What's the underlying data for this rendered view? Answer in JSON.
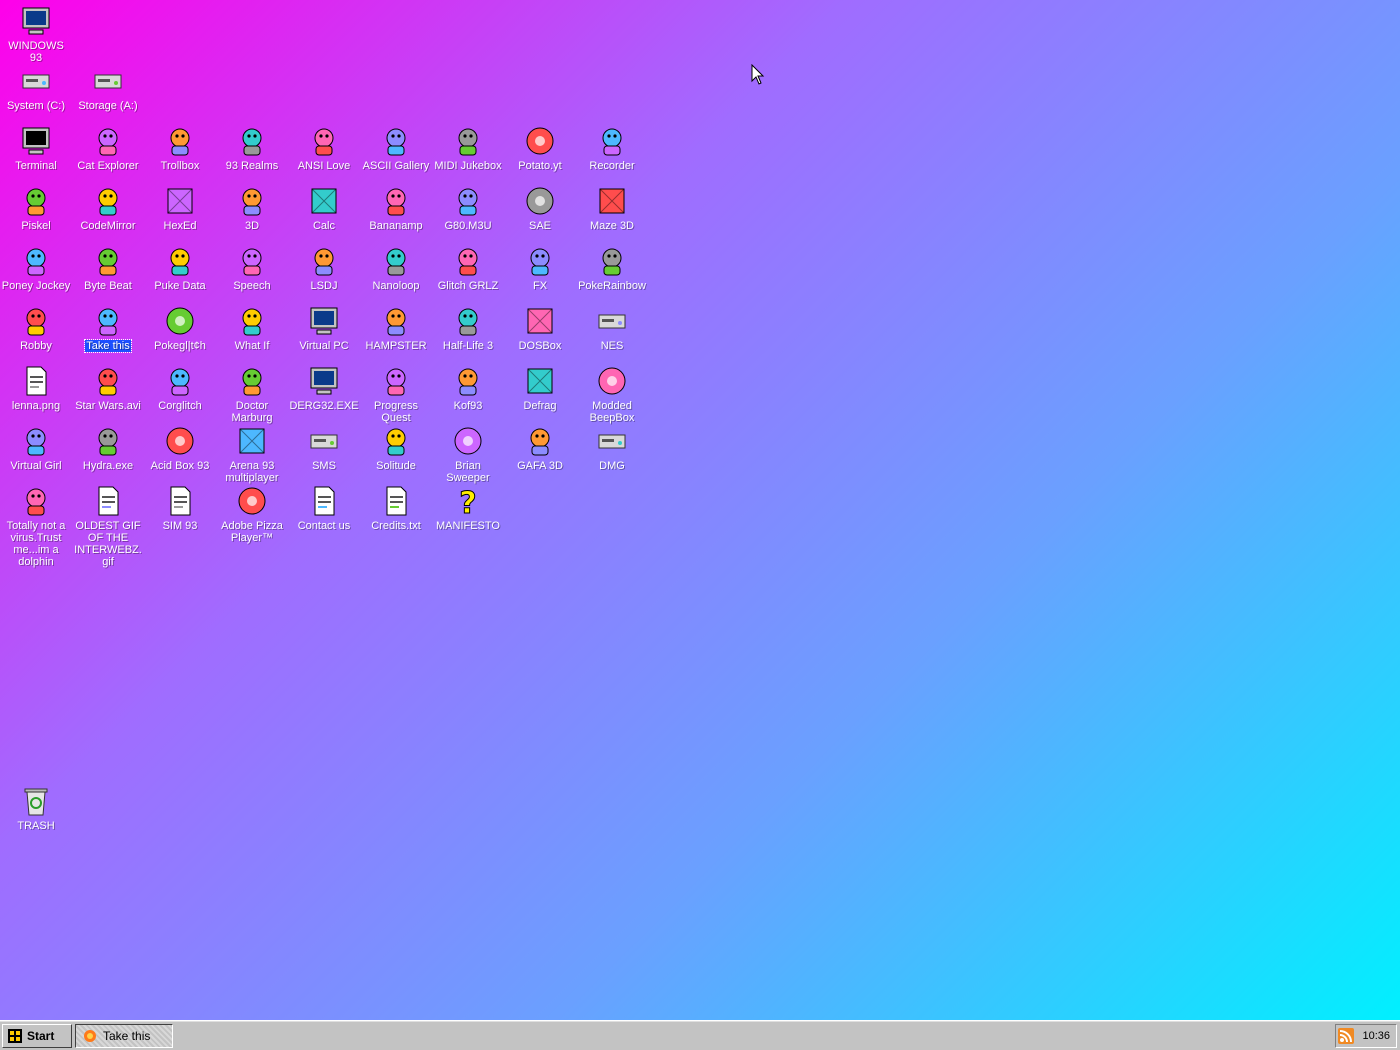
{
  "desktop": {
    "background_colors": [
      "#ff00ea",
      "#a06cff",
      "#6aa0ff",
      "#00f0ff"
    ],
    "icons": [
      {
        "label": "WINDOWS 93",
        "icon": "computer-icon",
        "col": 0,
        "row": 0
      },
      {
        "label": "System (C:)",
        "icon": "drive-icon",
        "col": 0,
        "row": 1
      },
      {
        "label": "Storage (A:)",
        "icon": "floppy-drive-icon",
        "col": 1,
        "row": 1
      },
      {
        "label": "Terminal",
        "icon": "terminal-icon",
        "col": 0,
        "row": 2
      },
      {
        "label": "Cat Explorer",
        "icon": "globe-icon",
        "col": 1,
        "row": 2
      },
      {
        "label": "Trollbox",
        "icon": "chat-icon",
        "col": 2,
        "row": 2
      },
      {
        "label": "93 Realms",
        "icon": "realms-icon",
        "col": 3,
        "row": 2
      },
      {
        "label": "ANSI Love",
        "icon": "ansi-icon",
        "col": 4,
        "row": 2
      },
      {
        "label": "ASCII Gallery",
        "icon": "ascii-icon",
        "col": 5,
        "row": 2
      },
      {
        "label": "MIDI Jukebox",
        "icon": "piano-icon",
        "col": 6,
        "row": 2
      },
      {
        "label": "Potato.yt",
        "icon": "potato-icon",
        "col": 7,
        "row": 2
      },
      {
        "label": "Recorder",
        "icon": "microphone-icon",
        "col": 8,
        "row": 2
      },
      {
        "label": "Piskel",
        "icon": "palette-icon",
        "col": 0,
        "row": 3
      },
      {
        "label": "CodeMirror",
        "icon": "codemirror-icon",
        "col": 1,
        "row": 3
      },
      {
        "label": "HexEd",
        "icon": "hex-icon",
        "col": 2,
        "row": 3
      },
      {
        "label": "3D",
        "icon": "teapot-icon",
        "col": 3,
        "row": 3
      },
      {
        "label": "Calc",
        "icon": "calculator-icon",
        "col": 4,
        "row": 3
      },
      {
        "label": "Bananamp",
        "icon": "banana-icon",
        "col": 5,
        "row": 3
      },
      {
        "label": "G80.M3U",
        "icon": "playlist-icon",
        "col": 6,
        "row": 3
      },
      {
        "label": "SAE",
        "icon": "ball-icon",
        "col": 7,
        "row": 3
      },
      {
        "label": "Maze 3D",
        "icon": "maze-icon",
        "col": 8,
        "row": 3
      },
      {
        "label": "Poney Jockey",
        "icon": "pony-icon",
        "col": 0,
        "row": 4
      },
      {
        "label": "Byte Beat",
        "icon": "bytebeat-icon",
        "col": 1,
        "row": 4
      },
      {
        "label": "Puke Data",
        "icon": "pd-icon",
        "col": 2,
        "row": 4
      },
      {
        "label": "Speech",
        "icon": "face-icon",
        "col": 3,
        "row": 4
      },
      {
        "label": "LSDJ",
        "icon": "lsdj-icon",
        "col": 4,
        "row": 4
      },
      {
        "label": "Nanoloop",
        "icon": "wave-icon",
        "col": 5,
        "row": 4
      },
      {
        "label": "Glitch GRLZ",
        "icon": "lips-icon",
        "col": 6,
        "row": 4
      },
      {
        "label": "FX",
        "icon": "atom-icon",
        "col": 7,
        "row": 4
      },
      {
        "label": "PokeRainbow",
        "icon": "pokerainbow-icon",
        "col": 8,
        "row": 4
      },
      {
        "label": "Robby",
        "icon": "stickman-icon",
        "col": 0,
        "row": 5
      },
      {
        "label": "Take this",
        "icon": "blue-creature-icon",
        "col": 1,
        "row": 5,
        "selected": true
      },
      {
        "label": "Pokegl|t¢h",
        "icon": "pokeball-icon",
        "col": 2,
        "row": 5
      },
      {
        "label": "What If",
        "icon": "whatif-icon",
        "col": 3,
        "row": 5
      },
      {
        "label": "Virtual PC",
        "icon": "window-icon",
        "col": 4,
        "row": 5
      },
      {
        "label": "HAMPSTER",
        "icon": "hamster-icon",
        "col": 5,
        "row": 5
      },
      {
        "label": "Half-Life 3",
        "icon": "lambda-icon",
        "col": 6,
        "row": 5
      },
      {
        "label": "DOSBox",
        "icon": "dosbox-icon",
        "col": 7,
        "row": 5
      },
      {
        "label": "NES",
        "icon": "nes-icon",
        "col": 8,
        "row": 5
      },
      {
        "label": "lenna.png",
        "icon": "image-file-icon",
        "col": 0,
        "row": 6
      },
      {
        "label": "Star Wars.avi",
        "icon": "yoda-icon",
        "col": 1,
        "row": 6
      },
      {
        "label": "Corglitch",
        "icon": "corgi-icon",
        "col": 2,
        "row": 6
      },
      {
        "label": "Doctor Marburg",
        "icon": "doctor-icon",
        "col": 3,
        "row": 6
      },
      {
        "label": "DERG32.EXE",
        "icon": "monitor-face-icon",
        "col": 4,
        "row": 6
      },
      {
        "label": "Progress Quest",
        "icon": "swords-icon",
        "col": 5,
        "row": 6
      },
      {
        "label": "Kof93",
        "icon": "fighter-icon",
        "col": 6,
        "row": 6
      },
      {
        "label": "Defrag",
        "icon": "defrag-icon",
        "col": 7,
        "row": 6
      },
      {
        "label": "Modded BeepBox",
        "icon": "ring-icon",
        "col": 8,
        "row": 6
      },
      {
        "label": "Virtual Girl",
        "icon": "girl-face-icon",
        "col": 0,
        "row": 7
      },
      {
        "label": "Hydra.exe",
        "icon": "hydra-icon",
        "col": 1,
        "row": 7
      },
      {
        "label": "Acid Box 93",
        "icon": "smiley-icon",
        "col": 2,
        "row": 7
      },
      {
        "label": "Arena 93 multiplayer",
        "icon": "cube-icon",
        "col": 3,
        "row": 7
      },
      {
        "label": "SMS",
        "icon": "console-icon",
        "col": 4,
        "row": 7
      },
      {
        "label": "Solitude",
        "icon": "bottle-icon",
        "col": 5,
        "row": 7
      },
      {
        "label": "Brian Sweeper",
        "icon": "mine-icon",
        "col": 6,
        "row": 7
      },
      {
        "label": "GAFA 3D",
        "icon": "man-face-icon",
        "col": 7,
        "row": 7
      },
      {
        "label": "DMG",
        "icon": "gameboy-icon",
        "col": 8,
        "row": 7
      },
      {
        "label": "Totally not a virus.Trust me...im a dolphin",
        "icon": "dolphin-icon",
        "col": 0,
        "row": 8
      },
      {
        "label": "OLDEST GIF OF THE INTERWEBZ.gif",
        "icon": "gif-file-icon",
        "col": 1,
        "row": 8
      },
      {
        "label": "SIM 93",
        "icon": "book-icon",
        "col": 2,
        "row": 8
      },
      {
        "label": "Adobe Pizza Player™",
        "icon": "pizza-icon",
        "col": 3,
        "row": 8
      },
      {
        "label": "Contact us",
        "icon": "contact-icon",
        "col": 4,
        "row": 8
      },
      {
        "label": "Credits.txt",
        "icon": "text-file-icon",
        "col": 5,
        "row": 8
      },
      {
        "label": "MANIFESTO",
        "icon": "question-icon",
        "col": 6,
        "row": 8
      },
      {
        "label": "TRASH",
        "icon": "recycle-bin-icon",
        "col": 0,
        "row": 13
      }
    ]
  },
  "taskbar": {
    "start_label": "Start",
    "tasks": [
      {
        "label": "Take this",
        "icon": "blue-creature-icon"
      }
    ],
    "tray_icon": "rss-icon",
    "clock": "10:36"
  }
}
